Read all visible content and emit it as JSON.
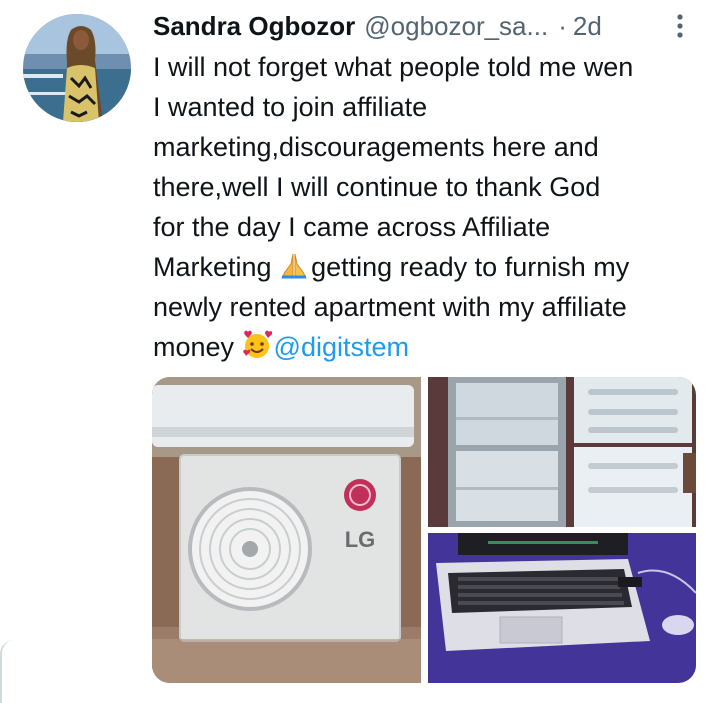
{
  "tweet": {
    "author_name": "Sandra Ogbozor",
    "handle": "@ogbozor_sa...",
    "separator": "·",
    "time": "2d",
    "text_lines": [
      "I will not forget what people told me wen",
      "I wanted to join affiliate",
      "marketing,discouragements here and",
      "there,well I will continue to thank God",
      "for the day I came across Affiliate"
    ],
    "line6_before": "Marketing ",
    "line6_after": "getting ready to furnish my",
    "line7": "newly rented apartment with my affiliate",
    "line8_before": "money ",
    "mention": "@digitstem"
  },
  "media": {
    "ac_brand": "LG"
  },
  "icons": {
    "more": "more-vertical-icon",
    "pray": "folded-hands-emoji",
    "hearts": "smiling-face-with-hearts-emoji"
  },
  "colors": {
    "accent": "#1d9bf0",
    "secondary_text": "#536471",
    "text": "#0f1419"
  }
}
